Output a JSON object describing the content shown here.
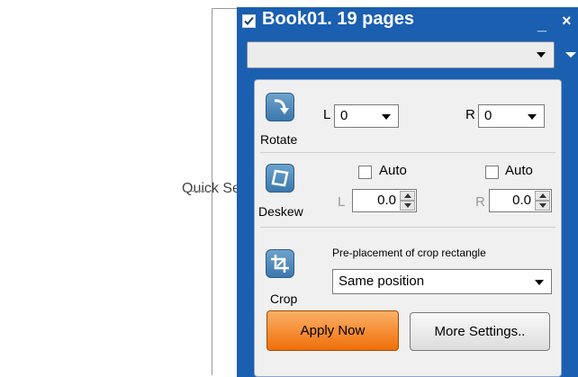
{
  "callout": {
    "label": "Quick Settings area"
  },
  "panel": {
    "title": "Book01. 19 pages",
    "title_checked": true,
    "minimize_glyph": "_",
    "close_glyph": "×",
    "main_select_value": ""
  },
  "rotate": {
    "label": "Rotate",
    "icon": "rotate-icon",
    "left_label": "L",
    "left_value": "0",
    "right_label": "R",
    "right_value": "0"
  },
  "deskew": {
    "label": "Deskew",
    "icon": "deskew-icon",
    "auto_left_label": "Auto",
    "auto_left_checked": false,
    "auto_right_label": "Auto",
    "auto_right_checked": false,
    "left_label": "L",
    "left_value": "0.0",
    "right_label": "R",
    "right_value": "0.0"
  },
  "crop": {
    "label": "Crop",
    "icon": "crop-icon",
    "caption": "Pre-placement of crop rectangle",
    "selected": "Same position"
  },
  "actions": {
    "apply_label": "Apply Now",
    "more_label": "More Settings.."
  },
  "colors": {
    "panel_blue": "#1b5fb0",
    "apply_orange": "#ef6f0a",
    "icon_blue": "#3b78ad"
  }
}
